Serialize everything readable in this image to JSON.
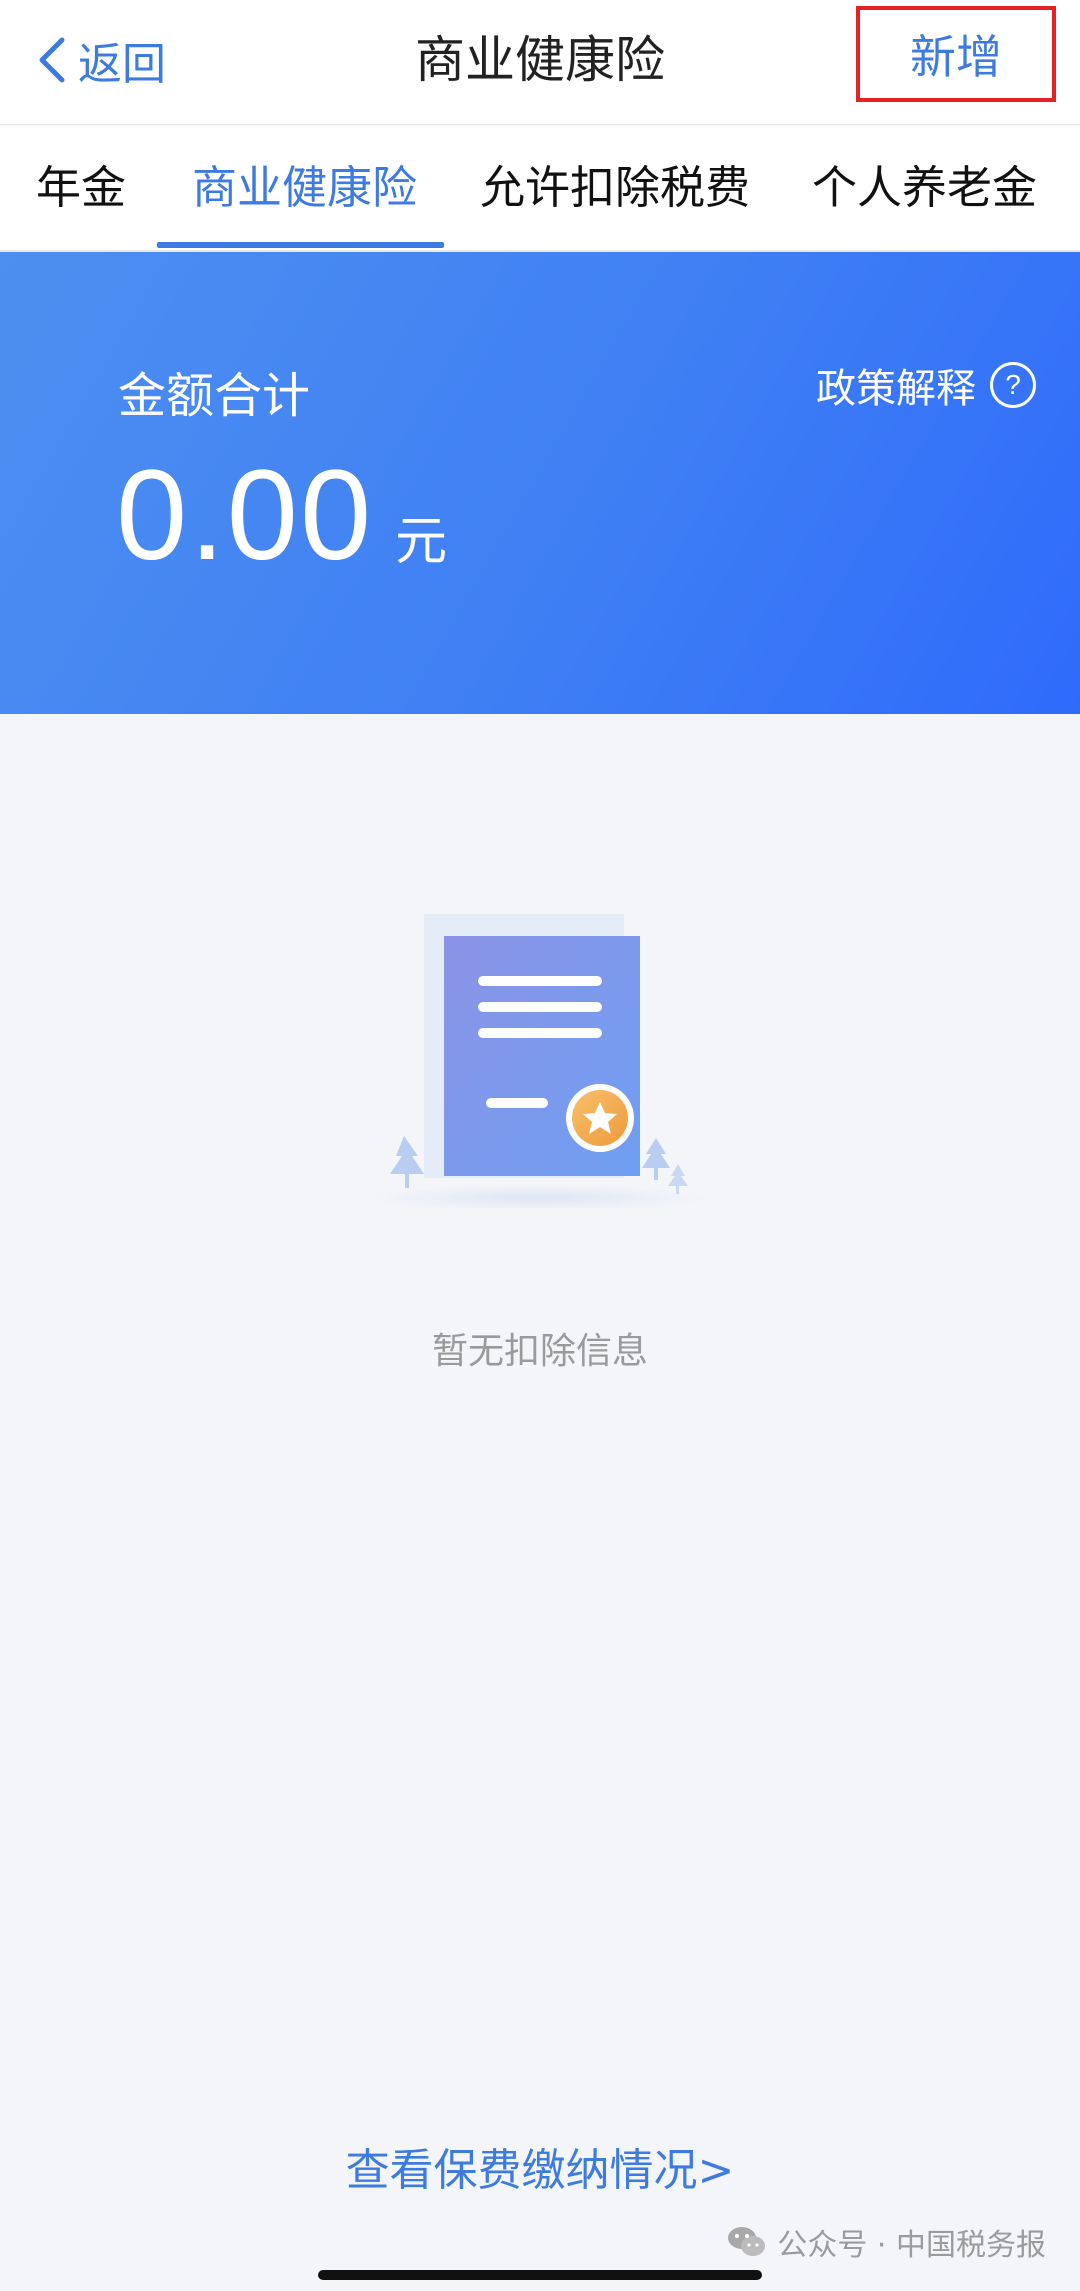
{
  "header": {
    "back_label": "返回",
    "title": "商业健康险",
    "add_label": "新增"
  },
  "tabs": [
    {
      "label": "年金",
      "active": false
    },
    {
      "label": "商业健康险",
      "active": true
    },
    {
      "label": "允许扣除税费",
      "active": false
    },
    {
      "label": "个人养老金",
      "active": false
    }
  ],
  "summary": {
    "label": "金额合计",
    "amount": "0.00",
    "unit": "元",
    "policy_label": "政策解释",
    "policy_icon": "?"
  },
  "empty": {
    "text": "暂无扣除信息",
    "illustration": "document-certificate-icon"
  },
  "footer": {
    "link_label": "查看保费缴纳情况>",
    "watermark": "公众号 · 中国税务报"
  },
  "colors": {
    "accent": "#3d7be0",
    "banner_start": "#4d8ff0",
    "banner_end": "#2f6bfb",
    "highlight_border": "#e52222",
    "page_bg": "#f3f5f9"
  }
}
